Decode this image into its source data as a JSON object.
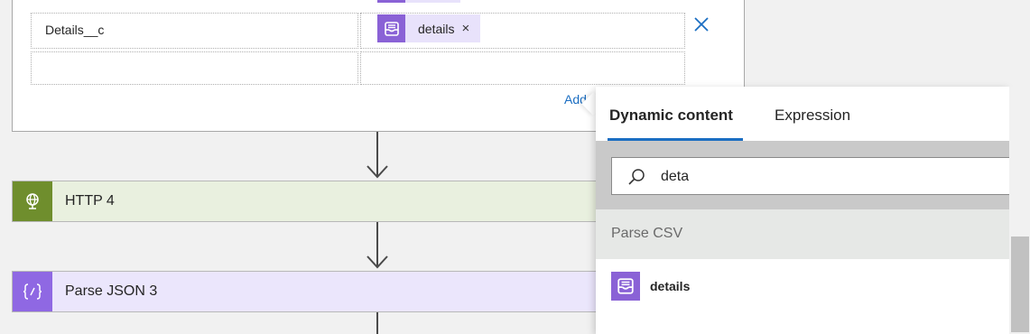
{
  "mapping": {
    "rows": [
      {
        "key": "Details__c",
        "token": {
          "label": "details",
          "icon": "inbox-icon",
          "remove": "×"
        }
      },
      {
        "key": "",
        "token": null
      }
    ],
    "add_link": "Add"
  },
  "actions": [
    {
      "title": "HTTP 4",
      "icon": "globe-icon",
      "accent": "#6f8e2d"
    },
    {
      "title": "Parse JSON 3",
      "icon": "braces-icon",
      "accent": "#8f68e3"
    }
  ],
  "popup": {
    "tabs": [
      {
        "label": "Dynamic content",
        "active": true
      },
      {
        "label": "Expression",
        "active": false
      }
    ],
    "search": {
      "value": "deta",
      "placeholder": ""
    },
    "group": {
      "label": "Parse CSV"
    },
    "results": [
      {
        "label": "details",
        "icon": "inbox-icon"
      }
    ]
  },
  "colors": {
    "accent": "#1b6ec2",
    "token_bg": "#e8e2fb",
    "token_icon": "#8a62d6"
  }
}
